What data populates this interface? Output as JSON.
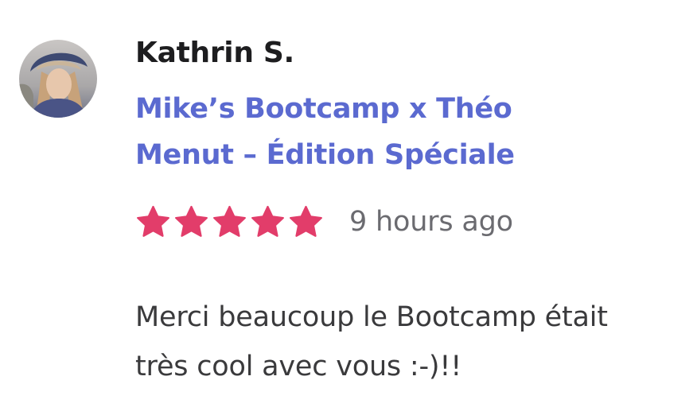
{
  "review": {
    "reviewer_name": "Kathrin S.",
    "product_title": "Mike’s Bootcamp x Théo Menut – Édition Spéciale",
    "rating": 5,
    "rating_max": 5,
    "time_ago": "9 hours ago",
    "text": "Merci beaucoup le Bootcamp était très cool avec vous :-)!!"
  },
  "colors": {
    "link": "#5b6ad0",
    "star": "#e23d6a",
    "name": "#1d1d1f",
    "muted": "#6b6b70",
    "body_text": "#3a3a3c"
  },
  "icons": {
    "avatar": "user-photo-avatar",
    "star": "star-icon"
  }
}
